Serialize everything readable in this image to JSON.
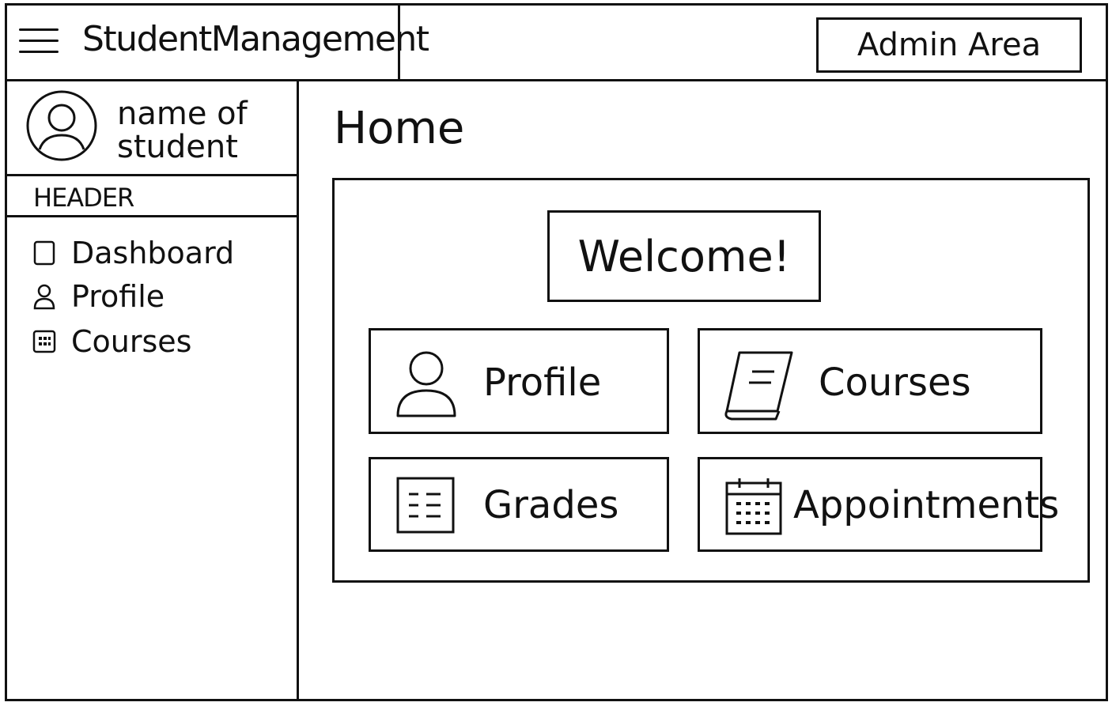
{
  "app": {
    "title": "StudentManagement",
    "menu_icon": "hamburger-menu-icon"
  },
  "header": {
    "admin_button": "Admin Area"
  },
  "sidebar": {
    "user": {
      "name_line1": "name of",
      "name_line2": "student",
      "avatar_icon": "user-avatar-icon"
    },
    "section_header": "HEADER",
    "items": [
      {
        "label": "Dashboard",
        "icon": "square-icon"
      },
      {
        "label": "Profile",
        "icon": "person-icon"
      },
      {
        "label": "Courses",
        "icon": "grid-icon"
      }
    ]
  },
  "main": {
    "title": "Home",
    "welcome": "Welcome!",
    "tiles": [
      {
        "label": "Profile",
        "icon": "person-icon"
      },
      {
        "label": "Courses",
        "icon": "book-icon"
      },
      {
        "label": "Grades",
        "icon": "grades-sheet-icon"
      },
      {
        "label": "Appointments",
        "icon": "calendar-icon"
      }
    ]
  }
}
